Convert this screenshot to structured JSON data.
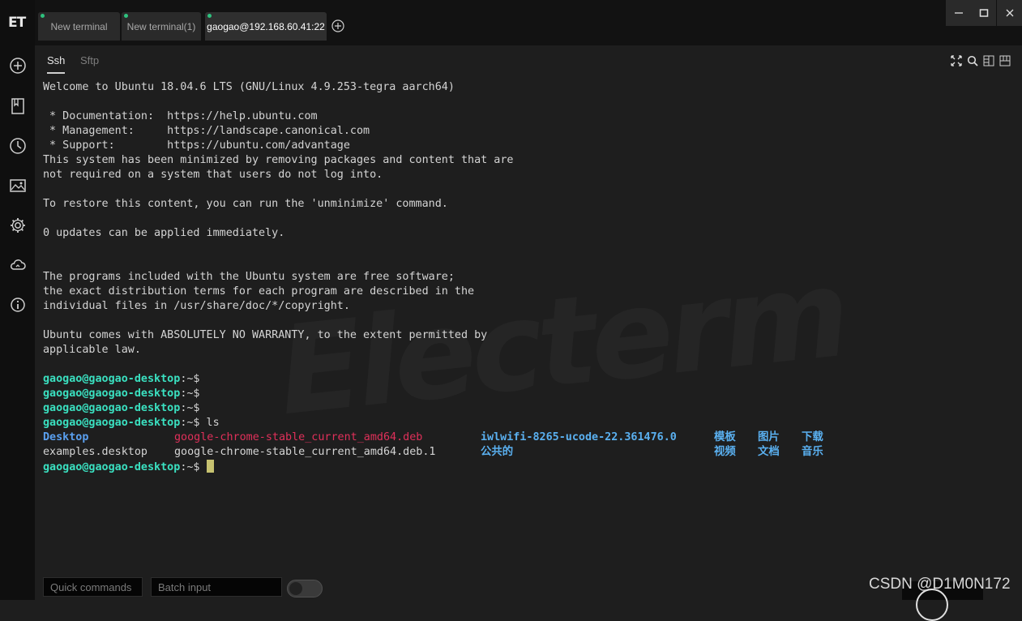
{
  "app": {
    "logo": "ET"
  },
  "sidebar": {
    "icons": [
      "add-bookmark-icon",
      "bookmark-icon",
      "history-icon",
      "image-icon",
      "settings-icon",
      "cloud-sync-icon",
      "info-icon"
    ]
  },
  "tabs": [
    {
      "label": "New terminal"
    },
    {
      "label": "New terminal(1)"
    },
    {
      "label": "gaogao@192.168.60.41:22"
    }
  ],
  "session": {
    "subtabs": [
      "Ssh",
      "Sftp"
    ]
  },
  "terminal": {
    "lines": [
      "Welcome to Ubuntu 18.04.6 LTS (GNU/Linux 4.9.253-tegra aarch64)",
      "",
      " * Documentation:  https://help.ubuntu.com",
      " * Management:     https://landscape.canonical.com",
      " * Support:        https://ubuntu.com/advantage",
      "This system has been minimized by removing packages and content that are",
      "not required on a system that users do not log into.",
      "",
      "To restore this content, you can run the 'unminimize' command.",
      "",
      "0 updates can be applied immediately.",
      "",
      "",
      "The programs included with the Ubuntu system are free software;",
      "the exact distribution terms for each program are described in the",
      "individual files in /usr/share/doc/*/copyright.",
      "",
      "Ubuntu comes with ABSOLUTELY NO WARRANTY, to the extent permitted by",
      "applicable law.",
      ""
    ],
    "prompt_user": "gaogao@gaogao-desktop",
    "prompt_suffix": ":~$",
    "ls_command": " ls",
    "ls_row1": {
      "a": "Desktop",
      "b": "google-chrome-stable_current_amd64.deb",
      "c": "iwlwifi-8265-ucode-22.361476.0",
      "d": "模板",
      "e": "图片",
      "f": "下载"
    },
    "ls_row2": {
      "a": "examples.desktop",
      "b": "google-chrome-stable_current_amd64.deb.1",
      "c": "公共的",
      "d": "视频",
      "e": "文档",
      "f": "音乐"
    },
    "watermark": "Electerm",
    "colors": {
      "prompt": "#3ae0c0",
      "dir": "#5aa0f0",
      "archive": "#e0305a",
      "cursor": "#c7c270"
    }
  },
  "bottom": {
    "quick_commands": "Quick commands",
    "batch_input": "Batch input"
  },
  "watermark_text": "CSDN @D1M0N172"
}
